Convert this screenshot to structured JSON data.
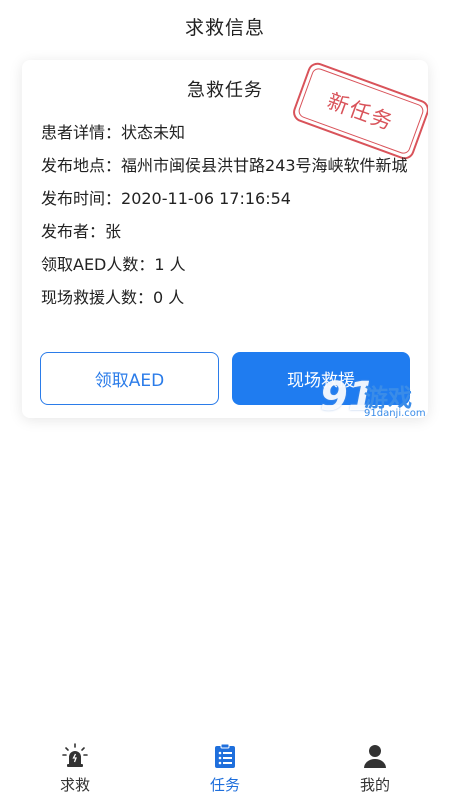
{
  "header": {
    "title": "求救信息"
  },
  "card": {
    "title": "急救任务",
    "stamp": "新任务",
    "rows": [
      {
        "label": "患者详情：",
        "value": "状态未知"
      },
      {
        "label": "发布地点：",
        "value": "福州市闽侯县洪甘路243号海峡软件新城"
      },
      {
        "label": "发布时间：",
        "value": "2020-11-06 17:16:54"
      },
      {
        "label": "发布者：",
        "value": "张"
      },
      {
        "label": "领取AED人数：",
        "value": "1 人"
      },
      {
        "label": "现场救援人数：",
        "value": "0 人"
      }
    ],
    "btn_aed": "领取AED",
    "btn_rescue": "现场救援"
  },
  "watermark": {
    "big": "91",
    "cn": "游戏",
    "url": "91danji.com"
  },
  "tabbar": {
    "items": [
      {
        "label": "求救",
        "icon": "alarm-icon"
      },
      {
        "label": "任务",
        "icon": "task-list-icon",
        "active": true
      },
      {
        "label": "我的",
        "icon": "person-icon"
      }
    ]
  },
  "colors": {
    "accent": "#1f7cf0",
    "stamp": "#d9535a",
    "active_tab": "#1f6fdc"
  }
}
